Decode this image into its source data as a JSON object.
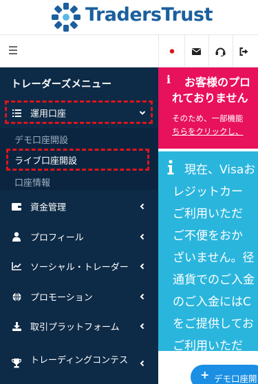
{
  "header": {
    "logo_text": "TradersTrust",
    "brand_color": "#1b5f9e"
  },
  "toolbar": {
    "icons": [
      "menu-icon",
      "japan-flag-icon",
      "envelope-icon",
      "headset-icon",
      "sign-out-icon"
    ]
  },
  "sidebar": {
    "title": "トレーダーズメニュー",
    "background": "#0d2a46",
    "items": [
      {
        "label": "運用口座",
        "icon": "list-icon",
        "expanded": true,
        "sub_items": [
          {
            "label": "デモ口座開設"
          },
          {
            "label": "ライブ口座開設",
            "active": true
          },
          {
            "label": "口座情報"
          }
        ]
      },
      {
        "label": "資金管理",
        "icon": "wallet-icon"
      },
      {
        "label": "プロフィール",
        "icon": "user-icon"
      },
      {
        "label": "ソーシャル・トレーダー",
        "icon": "chart-line-icon"
      },
      {
        "label": "プロモーション",
        "icon": "globe-icon"
      },
      {
        "label": "取引プラットフォーム",
        "icon": "download-icon"
      },
      {
        "label": "トレーディングコンテス",
        "icon": "trophy-icon"
      }
    ]
  },
  "alert": {
    "line1": "お客様のプロ",
    "line2": "れておりません",
    "line3": "そのため、一部機能",
    "line4": "ちらをクリックし、",
    "color": "#e8115b"
  },
  "info": {
    "lines": [
      "現在、Visaお",
      "レジットカー",
      "ご利用いただ",
      "ご不便をおか",
      "ざいません。径",
      "通貨でのご入金",
      "のご入金にはC",
      "をご提供してお",
      "ご利用いただ"
    ],
    "color": "#2ab5dd"
  },
  "demo_button": {
    "plus": "+",
    "label": "デモ口座開"
  }
}
